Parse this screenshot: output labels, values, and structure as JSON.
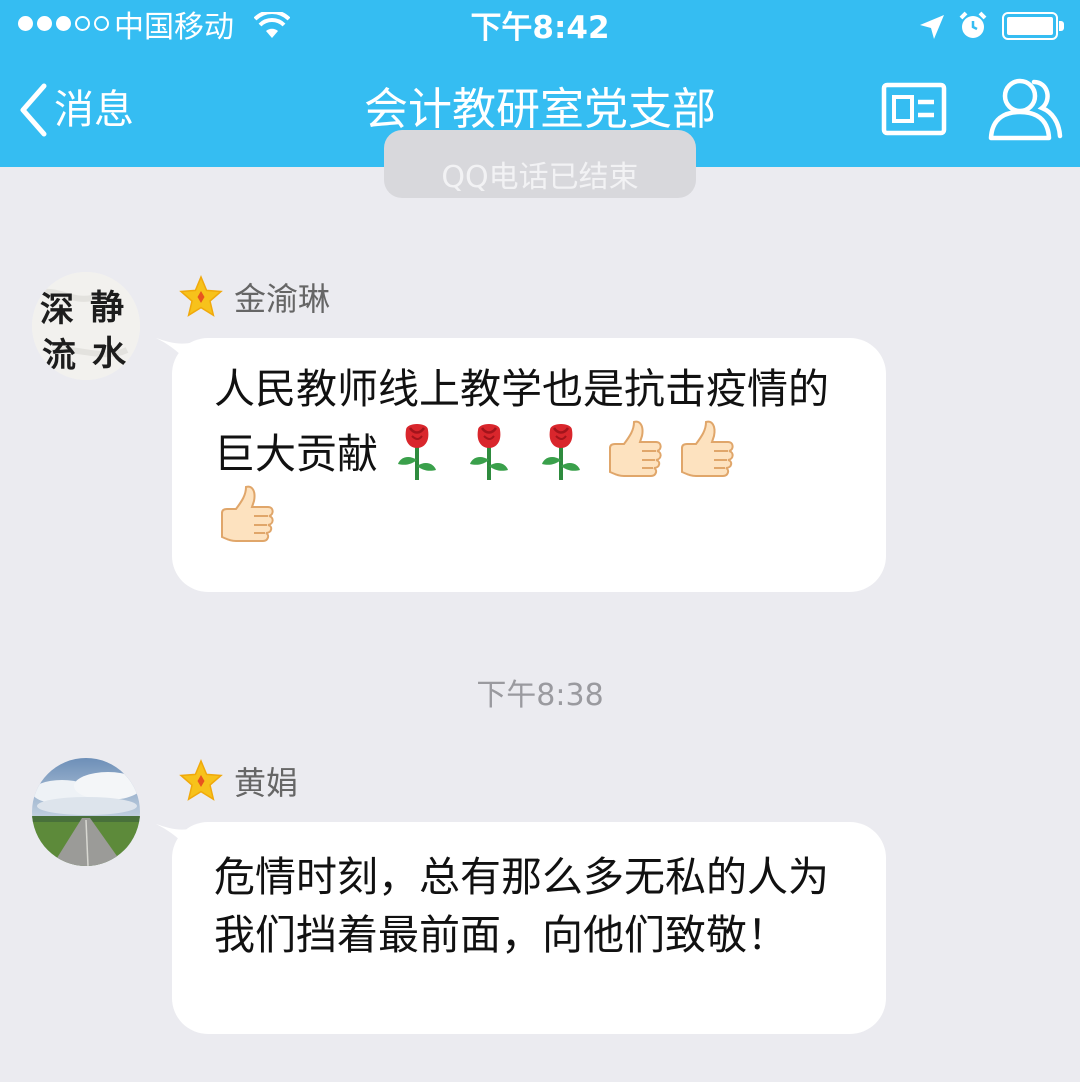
{
  "status_bar": {
    "carrier": "中国移动",
    "time": "下午8:42",
    "signal_bars_filled": 3,
    "signal_bars_total": 5
  },
  "nav": {
    "back_label": "消息",
    "title": "会计教研室党支部"
  },
  "system_message": "QQ电话已结束",
  "messages": [
    {
      "sender": "金渝琳",
      "text": "人民教师线上教学也是抗击疫情的巨大贡献",
      "emoji": [
        "rose",
        "rose",
        "rose",
        "thumbs-up",
        "thumbs-up",
        "thumbs-up"
      ],
      "avatar_calligraphy": [
        "静",
        "水",
        "深",
        "流"
      ]
    },
    {
      "timestamp": "下午8:38"
    },
    {
      "sender": "黄娟",
      "text": "危情时刻，总有那么多无私的人为我们挡着最前面，向他们致敬！"
    }
  ],
  "colors": {
    "header_bg": "#35bdf2",
    "chat_bg": "#ebebf0",
    "bubble_bg": "#ffffff",
    "star_gold": "#f7c21b"
  }
}
